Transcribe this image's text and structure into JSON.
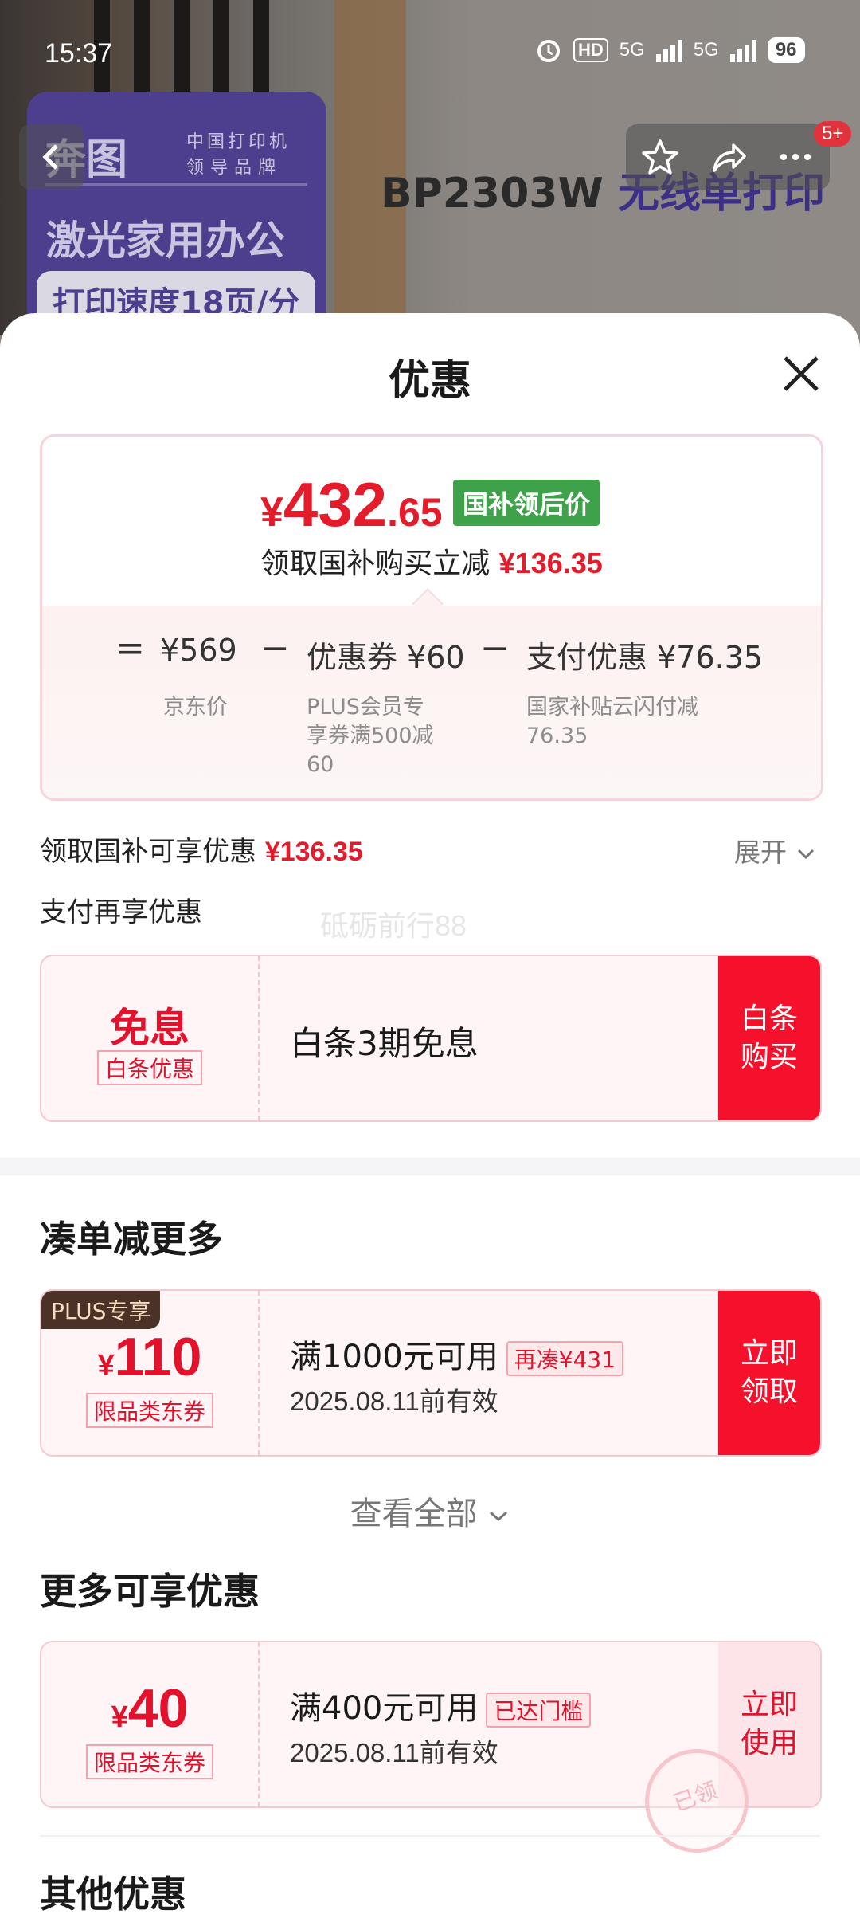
{
  "status_bar": {
    "time": "15:37",
    "hd": "HD",
    "net1": "5G",
    "net2": "5G",
    "battery": "96"
  },
  "product_bg": {
    "brand_logo": "奔图",
    "brand_tag_1": "中国打印机",
    "brand_tag_2": "领导品牌",
    "promo_title": "激光家用办公",
    "promo_pill": "打印速度18页/分",
    "product_name_1": "BP2303W",
    "product_name_2": "无线单打印"
  },
  "nav": {
    "badge": "5+",
    "icons": [
      "back-icon",
      "star-icon",
      "share-icon",
      "more-icon"
    ]
  },
  "sheet": {
    "title": "优惠",
    "summary": {
      "currency": "¥",
      "price_int": "432",
      "price_dec": ".65",
      "tag": "国补领后价",
      "instant_label": "领取国补购买立减",
      "instant_amount": "¥136.35",
      "eq": "=",
      "minus1": "−",
      "minus2": "−",
      "item1_value": "¥569",
      "item1_label": "京东价",
      "item2_value": "优惠券 ¥60",
      "item2_label_l1": "PLUS会员专",
      "item2_label_l2": "享券满500减",
      "item2_label_l3": "60",
      "item3_value": "支付优惠 ¥76.35",
      "item3_label_l1": "国家补贴云闪付减",
      "item3_label_l2": "76.35"
    },
    "subsidy_row": {
      "label": "领取国补可享优惠",
      "amount": "¥136.35",
      "expand": "展开"
    },
    "pay_row": {
      "label": "支付再享优惠"
    },
    "watermark": "砥砺前行88",
    "baitiao": {
      "big": "免息",
      "tag": "白条优惠",
      "title": "白条3期免息",
      "cta_l1": "白条",
      "cta_l2": "购买"
    },
    "section_more": "凑单减更多",
    "coupon_plus": {
      "plus_tag": "PLUS专享",
      "currency": "¥",
      "amount": "110",
      "type": "限品类东券",
      "title": "满1000元可用",
      "chip": "再凑¥431",
      "date": "2025.08.11前有效",
      "cta_l1": "立即",
      "cta_l2": "领取"
    },
    "view_all": "查看全部",
    "section_extra": "更多可享优惠",
    "coupon_40": {
      "currency": "¥",
      "amount": "40",
      "type": "限品类东券",
      "title": "满400元可用",
      "chip": "已达门槛",
      "date": "2025.08.11前有效",
      "cta_l1": "立即",
      "cta_l2": "使用",
      "stamp": "已领"
    },
    "section_other": "其他优惠"
  },
  "colors": {
    "accent_red": "#e31b2a",
    "cta_red": "#f5102c",
    "subsidy_green": "#3ea24a",
    "plus_brown": "#4a3226"
  }
}
